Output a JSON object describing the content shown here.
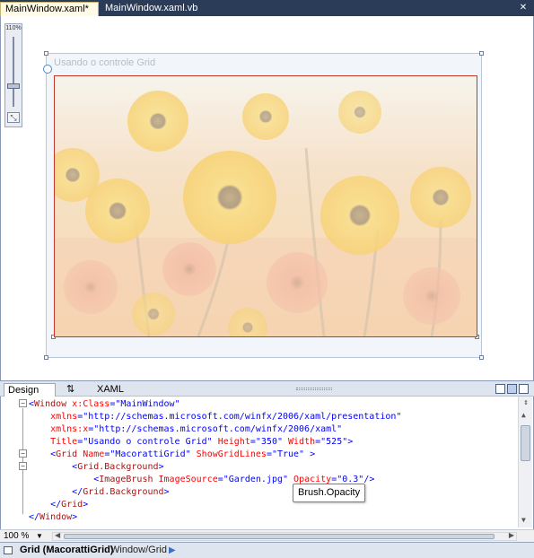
{
  "tabs": {
    "active": "MainWindow.xaml*",
    "inactive": "MainWindow.xaml.vb",
    "close_glyph": "✕"
  },
  "designer": {
    "zoom_label": "110%",
    "fit_glyph": "⤡",
    "window_title": "Usando o controle Grid",
    "image_hint": "Garden.jpg",
    "accent_color": "#c0392b"
  },
  "split": {
    "design_label": "Design",
    "swap_label": "⇅",
    "xaml_label": "XAML"
  },
  "code": {
    "lines": [
      [
        {
          "c": "b",
          "t": "<"
        },
        {
          "c": "t",
          "t": "Window"
        },
        {
          "c": "a",
          "t": " x:Class"
        },
        {
          "c": "b",
          "t": "=\"MainWindow\""
        }
      ],
      [
        {
          "c": "a",
          "t": "    xmlns"
        },
        {
          "c": "b",
          "t": "=\"http://schemas.microsoft.com/winfx/2006/xaml/presentation\""
        }
      ],
      [
        {
          "c": "a",
          "t": "    xmlns:x"
        },
        {
          "c": "b",
          "t": "=\"http://schemas.microsoft.com/winfx/2006/xaml\""
        }
      ],
      [
        {
          "c": "a",
          "t": "    Title"
        },
        {
          "c": "b",
          "t": "=\"Usando o controle Grid\""
        },
        {
          "c": "a",
          "t": " Height"
        },
        {
          "c": "b",
          "t": "=\"350\""
        },
        {
          "c": "a",
          "t": " Width"
        },
        {
          "c": "b",
          "t": "=\"525\""
        },
        {
          "c": "b",
          "t": ">"
        }
      ],
      [
        {
          "c": "b",
          "t": "    <"
        },
        {
          "c": "t",
          "t": "Grid"
        },
        {
          "c": "a",
          "t": " Name"
        },
        {
          "c": "b",
          "t": "=\"MacorattiGrid\""
        },
        {
          "c": "a",
          "t": " ShowGridLines"
        },
        {
          "c": "b",
          "t": "=\"True\""
        },
        {
          "c": "b",
          "t": " >"
        }
      ],
      [
        {
          "c": "b",
          "t": "        <"
        },
        {
          "c": "t",
          "t": "Grid.Background"
        },
        {
          "c": "b",
          "t": ">"
        }
      ],
      [
        {
          "c": "b",
          "t": "            <"
        },
        {
          "c": "t",
          "t": "ImageBrush"
        },
        {
          "c": "a",
          "t": " ImageSource"
        },
        {
          "c": "b",
          "t": "=\"Garden.jpg\""
        },
        {
          "c": "a",
          "t": " Opacity"
        },
        {
          "c": "b",
          "t": "=\"0.3\""
        },
        {
          "c": "b",
          "t": "/>"
        }
      ],
      [
        {
          "c": "b",
          "t": "        </"
        },
        {
          "c": "t",
          "t": "Grid.Background"
        },
        {
          "c": "b",
          "t": ">"
        }
      ],
      [
        {
          "c": "b",
          "t": "    </"
        },
        {
          "c": "t",
          "t": "Grid"
        },
        {
          "c": "b",
          "t": ">"
        }
      ],
      [
        {
          "c": "b",
          "t": "</"
        },
        {
          "c": "t",
          "t": "Window"
        },
        {
          "c": "b",
          "t": ">"
        }
      ]
    ],
    "tooltip": "Brush.Opacity"
  },
  "zoom_bar": {
    "value": "100 %",
    "arrow": "▼"
  },
  "status": {
    "element": "Grid (MacorattiGrid)",
    "path": "Window/Grid",
    "arrow": "▶"
  }
}
